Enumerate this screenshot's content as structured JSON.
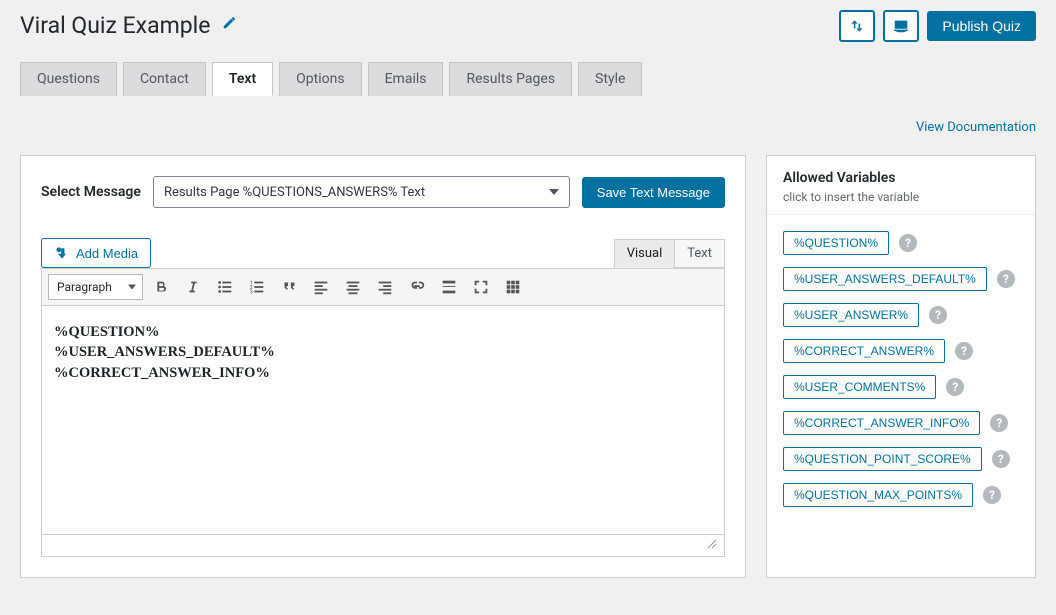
{
  "header": {
    "title": "Viral Quiz Example",
    "publish_label": "Publish Quiz"
  },
  "tabs": [
    "Questions",
    "Contact",
    "Text",
    "Options",
    "Emails",
    "Results Pages",
    "Style"
  ],
  "active_tab_index": 2,
  "doc_link": "View Documentation",
  "select_message": {
    "label": "Select Message",
    "value": "Results Page %QUESTIONS_ANSWERS% Text",
    "save_label": "Save Text Message"
  },
  "editor": {
    "add_media_label": "Add Media",
    "visual_tab": "Visual",
    "text_tab": "Text",
    "active_editor_tab": "Visual",
    "paragraph_select": "Paragraph",
    "content_lines": [
      "%QUESTION%",
      "%USER_ANSWERS_DEFAULT%",
      "%CORRECT_ANSWER_INFO%"
    ]
  },
  "allowed_variables": {
    "title": "Allowed Variables",
    "subtitle": "click to insert the variable",
    "items": [
      "%QUESTION%",
      "%USER_ANSWERS_DEFAULT%",
      "%USER_ANSWER%",
      "%CORRECT_ANSWER%",
      "%USER_COMMENTS%",
      "%CORRECT_ANSWER_INFO%",
      "%QUESTION_POINT_SCORE%",
      "%QUESTION_MAX_POINTS%"
    ]
  },
  "toolbar_icons": [
    "bold",
    "italic",
    "bullet-list",
    "number-list",
    "blockquote",
    "align-left",
    "align-center",
    "align-right",
    "link",
    "read-more",
    "fullscreen",
    "toolbar-toggle"
  ]
}
